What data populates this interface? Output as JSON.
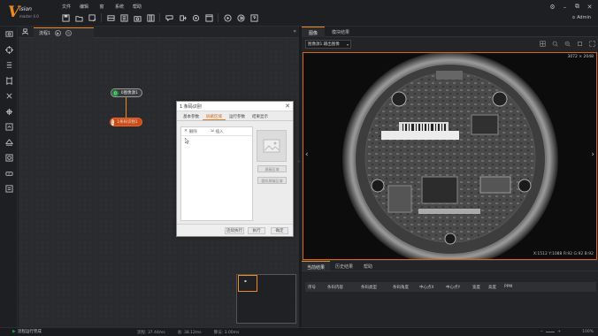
{
  "app": {
    "logo_letter": "V",
    "logo_word": "ision",
    "logo_sub": "master 4.0"
  },
  "menu": [
    "文件",
    "编辑",
    "窗",
    "系统",
    "帮助"
  ],
  "toolbar_icons": [
    "save-icon",
    "open-folder-icon",
    "save-as-icon",
    "layout-icon",
    "image-source-icon",
    "camera-icon",
    "module-list-icon",
    "communication-icon",
    "export-icon",
    "settings-icon",
    "window-icon",
    "run-once-icon",
    "run-loop-icon",
    "help-icon"
  ],
  "user": {
    "name": "Admin"
  },
  "left_bar_icons": [
    "image-icon",
    "locate-icon",
    "measure-icon",
    "recognize-icon",
    "deep-learning-icon",
    "calibrate-icon",
    "compare-icon",
    "color-icon",
    "defect-icon",
    "logic-icon",
    "communication-icon",
    "tool-icon"
  ],
  "flow": {
    "tab_label": "流程1",
    "node1_label": "0图像源1",
    "node2_label": "1条码识别1",
    "node1_index": "0",
    "node2_index": "1"
  },
  "dialog": {
    "title": "1 条码识别",
    "tabs": [
      "基本参数",
      "屏蔽区域",
      "运行参数",
      "结果显示"
    ],
    "active_tab": 1,
    "list_delete": "删除",
    "list_add": "插入",
    "side_btn1": "屏蔽区域",
    "side_btn2": "圆形屏蔽区域",
    "btn_execute": "连续执行",
    "btn_run": "执行",
    "btn_ok": "确定"
  },
  "right_tabs": [
    "图像",
    "模块结果"
  ],
  "source_select": "图像源1.输出图像",
  "image_size": "3072 × 2048",
  "pixel_info": "X:1512 Y:1088 R:92 G:92 B:92",
  "result_tabs": [
    "当前结果",
    "历史结果",
    "帮助"
  ],
  "result_columns": [
    "序号",
    "条码内容",
    "条码类型",
    "条码角度",
    "中心点X",
    "中心点Y",
    "宽度",
    "高度",
    "PPM"
  ],
  "status": {
    "run_text": "流程运行完成",
    "flow_time": "流程: 37.44ms",
    "total_time": "总: 38.12ms",
    "algo_time": "算法: 3.00ms",
    "zoom": "100%"
  },
  "colors": {
    "accent": "#f08a1c",
    "node_start": "#1f9a3a",
    "node_active": "#d04a14"
  }
}
